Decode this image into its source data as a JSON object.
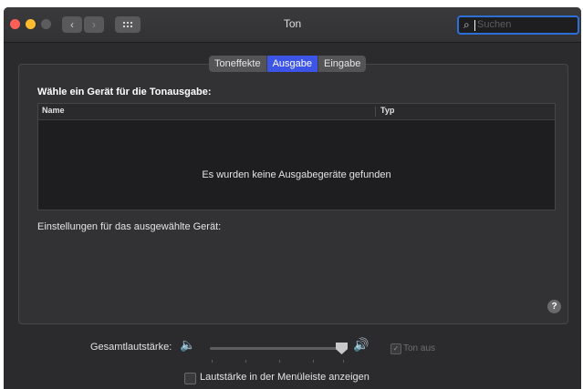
{
  "window": {
    "title": "Ton"
  },
  "toolbar": {
    "back_icon": "‹",
    "forward_icon": "›",
    "search_icon": "⌕",
    "search_placeholder": "Suchen"
  },
  "tabs": [
    {
      "label": "Toneffekte",
      "active": false
    },
    {
      "label": "Ausgabe",
      "active": true
    },
    {
      "label": "Eingabe",
      "active": false
    }
  ],
  "output": {
    "prompt": "Wähle ein Gerät für die Tonausgabe:",
    "columns": [
      "Name",
      "Typ"
    ],
    "empty_message": "Es wurden keine Ausgabegeräte gefunden",
    "settings_label": "Einstellungen für das ausgewählte Gerät:",
    "help_label": "?"
  },
  "volume": {
    "label": "Gesamtlautstärke:",
    "low_icon": "🔈",
    "high_icon": "🔊",
    "level": 1.0,
    "mute_label": "Ton aus",
    "mute_checked": true,
    "menubar_label": "Lautstärke in der Menüleiste anzeigen",
    "menubar_checked": false
  },
  "colors": {
    "accent": "#3c55e6",
    "search_focus": "#2c6fd6",
    "close": "#fe5f57",
    "minimize": "#febc2e"
  }
}
